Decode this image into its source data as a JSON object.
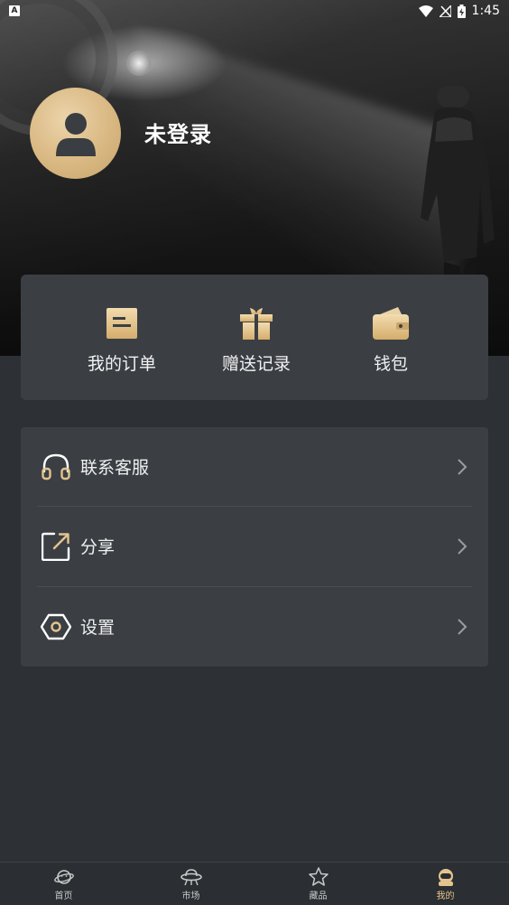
{
  "status_bar": {
    "left_badge": "A",
    "time": "1:45",
    "icons": [
      "wifi-icon",
      "no-signal-icon",
      "battery-charging-icon"
    ]
  },
  "profile": {
    "avatar_icon": "person-icon",
    "title": "未登录"
  },
  "quick_actions": [
    {
      "label": "我的订单",
      "icon": "order-icon"
    },
    {
      "label": "赠送记录",
      "icon": "gift-icon"
    },
    {
      "label": "钱包",
      "icon": "wallet-icon"
    }
  ],
  "menu": [
    {
      "label": "联系客服",
      "icon": "headset-icon"
    },
    {
      "label": "分享",
      "icon": "share-icon"
    },
    {
      "label": "设置",
      "icon": "settings-hexagon-icon"
    }
  ],
  "bottom_nav": [
    {
      "label": "首页",
      "icon": "planet-icon"
    },
    {
      "label": "市场",
      "icon": "ufo-icon"
    },
    {
      "label": "藏品",
      "icon": "star-icon"
    },
    {
      "label": "我的",
      "icon": "astronaut-icon",
      "active": true
    }
  ],
  "colors": {
    "accent_gold": "#e3c48f",
    "card_bg": "#3b3f44",
    "page_bg": "#2d3034"
  }
}
